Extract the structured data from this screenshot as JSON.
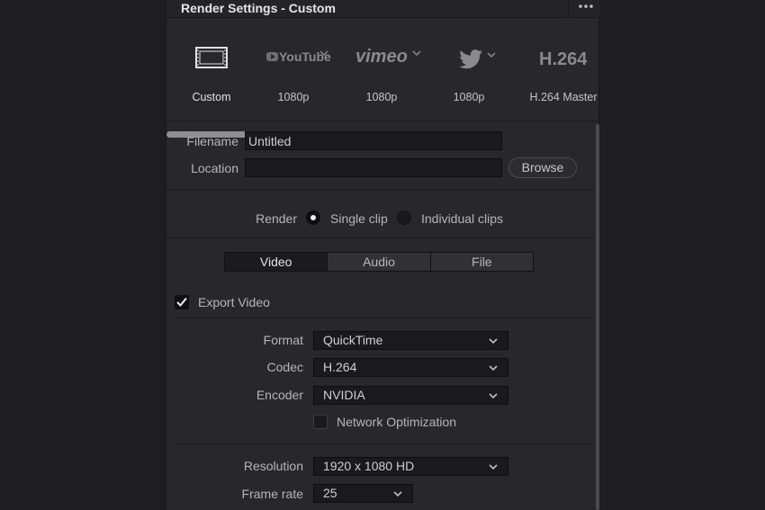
{
  "window": {
    "title": "Render Settings - Custom",
    "menu_icon": "more-horizontal-icon"
  },
  "presets": [
    {
      "name": "Custom",
      "icon": "film-strip-icon",
      "label": "Custom",
      "selected": true
    },
    {
      "name": "YouTube",
      "icon": "youtube-logo-icon",
      "logo_text": "YouTube",
      "label": "1080p",
      "has_dropdown": true
    },
    {
      "name": "Vimeo",
      "icon": "vimeo-logo-icon",
      "logo_text": "vimeo",
      "label": "1080p",
      "has_dropdown": true
    },
    {
      "name": "Twitter",
      "icon": "twitter-bird-icon",
      "label": "1080p",
      "has_dropdown": true
    },
    {
      "name": "H.264",
      "icon": "h264-text-icon",
      "logo_text": "H.264",
      "label": "H.264 Master"
    }
  ],
  "file": {
    "filename_label": "Filename",
    "filename_value": "Untitled",
    "location_label": "Location",
    "location_value": "",
    "browse_label": "Browse"
  },
  "render": {
    "label": "Render",
    "single_clip": "Single clip",
    "individual_clips": "Individual clips",
    "selected": "Single clip"
  },
  "tabs": [
    {
      "label": "Video",
      "active": true
    },
    {
      "label": "Audio",
      "active": false
    },
    {
      "label": "File",
      "active": false
    }
  ],
  "video": {
    "export_video_label": "Export Video",
    "export_video_checked": true,
    "format_label": "Format",
    "format_value": "QuickTime",
    "codec_label": "Codec",
    "codec_value": "H.264",
    "encoder_label": "Encoder",
    "encoder_value": "NVIDIA",
    "network_opt_label": "Network Optimization",
    "network_opt_checked": false,
    "resolution_label": "Resolution",
    "resolution_value": "1920 x 1080 HD",
    "framerate_label": "Frame rate",
    "framerate_value": "25"
  },
  "colors": {
    "background": "#1e1e22",
    "panel": "#28282c",
    "field": "#1a1a1d",
    "text": "#c9c9cc",
    "text_bright": "#e6e6e9"
  }
}
